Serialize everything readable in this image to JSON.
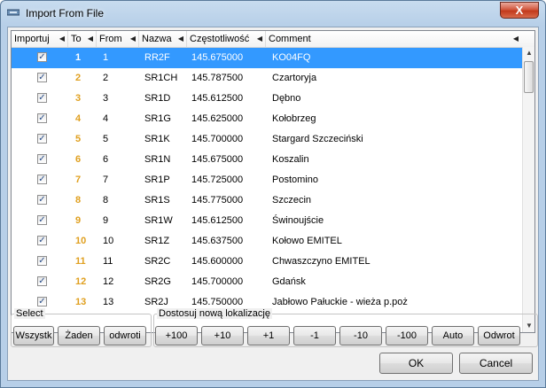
{
  "window": {
    "title": "Import From File",
    "close_label": "X"
  },
  "columns": {
    "importuj": "Importuj",
    "to": "To",
    "from": "From",
    "nazwa": "Nazwa",
    "freq": "Częstotliwość",
    "comment": "Comment"
  },
  "rows": [
    {
      "checked": true,
      "to": "1",
      "from": "1",
      "nazwa": "RR2F",
      "freq": "145.675000",
      "comment": "KO04FQ",
      "selected": true
    },
    {
      "checked": true,
      "to": "2",
      "from": "2",
      "nazwa": "SR1CH",
      "freq": "145.787500",
      "comment": "Czartoryja"
    },
    {
      "checked": true,
      "to": "3",
      "from": "3",
      "nazwa": "SR1D",
      "freq": "145.612500",
      "comment": "Dębno"
    },
    {
      "checked": true,
      "to": "4",
      "from": "4",
      "nazwa": "SR1G",
      "freq": "145.625000",
      "comment": "Kołobrzeg"
    },
    {
      "checked": true,
      "to": "5",
      "from": "5",
      "nazwa": "SR1K",
      "freq": "145.700000",
      "comment": "Stargard Szczeciński"
    },
    {
      "checked": true,
      "to": "6",
      "from": "6",
      "nazwa": "SR1N",
      "freq": "145.675000",
      "comment": "Koszalin"
    },
    {
      "checked": true,
      "to": "7",
      "from": "7",
      "nazwa": "SR1P",
      "freq": "145.725000",
      "comment": "Postomino"
    },
    {
      "checked": true,
      "to": "8",
      "from": "8",
      "nazwa": "SR1S",
      "freq": "145.775000",
      "comment": "Szczecin"
    },
    {
      "checked": true,
      "to": "9",
      "from": "9",
      "nazwa": "SR1W",
      "freq": "145.612500",
      "comment": "Świnoujście"
    },
    {
      "checked": true,
      "to": "10",
      "from": "10",
      "nazwa": "SR1Z",
      "freq": "145.637500",
      "comment": "Kołowo EMITEL"
    },
    {
      "checked": true,
      "to": "11",
      "from": "11",
      "nazwa": "SR2C",
      "freq": "145.600000",
      "comment": "Chwaszczyno EMITEL"
    },
    {
      "checked": true,
      "to": "12",
      "from": "12",
      "nazwa": "SR2G",
      "freq": "145.700000",
      "comment": "Gdańsk"
    },
    {
      "checked": true,
      "to": "13",
      "from": "13",
      "nazwa": "SR2J",
      "freq": "145.750000",
      "comment": "Jabłowo Pałuckie - wieża p.poż"
    }
  ],
  "select_group": {
    "label": "Select",
    "buttons": [
      "Wszystk",
      "Żaden",
      "odwroti"
    ]
  },
  "adjust_group": {
    "label": "Dostosuj nową lokalizację",
    "buttons": [
      "+100",
      "+10",
      "+1",
      "-1",
      "-10",
      "-100",
      "Auto",
      "Odwrot"
    ]
  },
  "dialog": {
    "ok": "OK",
    "cancel": "Cancel"
  },
  "colors": {
    "selection": "#3399ff",
    "to_column": "#e0a020"
  }
}
